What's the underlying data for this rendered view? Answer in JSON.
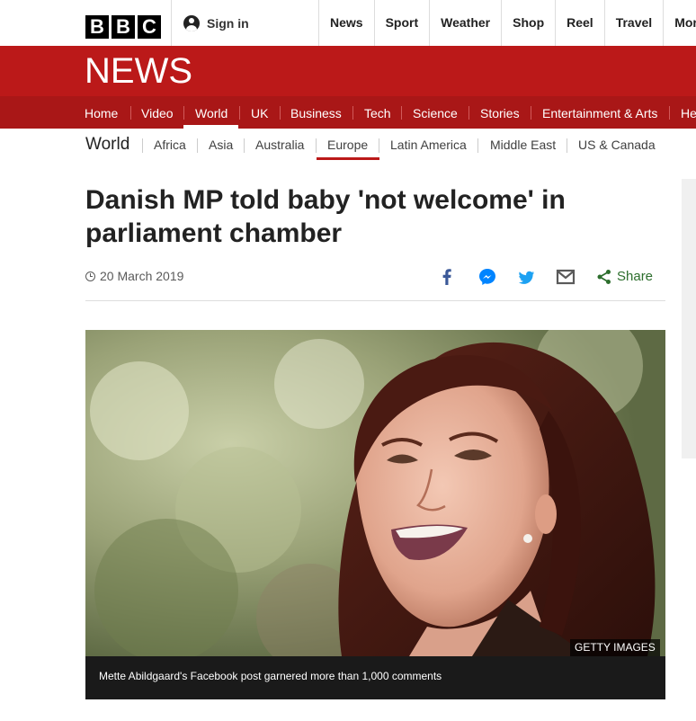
{
  "brand": {
    "letters": [
      "B",
      "B",
      "C"
    ],
    "news_wordmark": "NEWS"
  },
  "topbar": {
    "sign_in": "Sign in",
    "nav": [
      "News",
      "Sport",
      "Weather",
      "Shop",
      "Reel",
      "Travel",
      "More"
    ]
  },
  "news_nav": {
    "items": [
      "Home",
      "Video",
      "World",
      "UK",
      "Business",
      "Tech",
      "Science",
      "Stories",
      "Entertainment & Arts",
      "He"
    ],
    "active": "World"
  },
  "sub_nav": {
    "section": "World",
    "items": [
      "Africa",
      "Asia",
      "Australia",
      "Europe",
      "Latin America",
      "Middle East",
      "US & Canada"
    ],
    "active": "Europe"
  },
  "article": {
    "headline": "Danish MP told baby 'not welcome' in parliament chamber",
    "date": "20 March 2019",
    "share_label": "Share",
    "image_credit": "GETTY IMAGES",
    "image_caption": "Mette Abildgaard's Facebook post garnered more than 1,000 comments"
  },
  "share_icons": [
    "facebook-icon",
    "messenger-icon",
    "twitter-icon",
    "email-icon",
    "share-icon"
  ],
  "colors": {
    "bbc_red": "#bb1919",
    "nav_red": "#a91717",
    "share_green": "#2d6e2d",
    "facebook_blue": "#3b5998",
    "messenger_blue": "#0084ff",
    "twitter_blue": "#1da1f2"
  }
}
